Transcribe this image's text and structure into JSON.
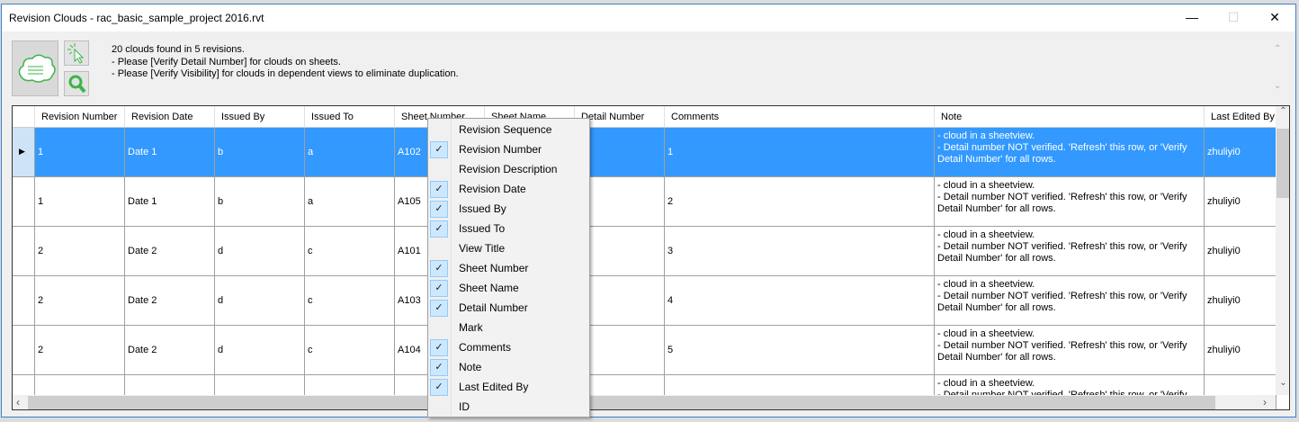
{
  "window": {
    "title": "Revision Clouds - rac_basic_sample_project 2016.rvt",
    "minimize": "—",
    "maximize": "☐",
    "close": "✕"
  },
  "toolbar": {
    "main_icon": "revision-cloud-icon",
    "select_icon": "cursor-select-icon",
    "zoom_icon": "magnifier-icon"
  },
  "message": {
    "line1": "20 clouds found in 5 revisions.",
    "line2": "- Please [Verify Detail Number] for clouds on sheets.",
    "line3": "- Please [Verify Visibility] for clouds in dependent views to eliminate duplication."
  },
  "grid": {
    "columns": [
      "Revision Number",
      "Revision Date",
      "Issued By",
      "Issued To",
      "Sheet Number",
      "Sheet Name",
      "Detail Number",
      "Comments",
      "Note",
      "Last Edited By"
    ],
    "rows": [
      {
        "rev": "1",
        "date": "Date 1",
        "by": "b",
        "to": "a",
        "sheet": "A102",
        "name": "",
        "detail": "",
        "comments": "1",
        "note": "- cloud in a sheetview.\n- Detail number NOT verified. 'Refresh' this row, or 'Verify Detail Number' for all rows.",
        "edited": "zhuliyi0"
      },
      {
        "rev": "1",
        "date": "Date 1",
        "by": "b",
        "to": "a",
        "sheet": "A105",
        "name": "",
        "detail": "",
        "comments": "2",
        "note": "- cloud in a sheetview.\n- Detail number NOT verified. 'Refresh' this row, or 'Verify Detail Number' for all rows.",
        "edited": "zhuliyi0"
      },
      {
        "rev": "2",
        "date": "Date 2",
        "by": "d",
        "to": "c",
        "sheet": "A101",
        "name": "",
        "detail": "",
        "comments": "3",
        "note": "- cloud in a sheetview.\n- Detail number NOT verified. 'Refresh' this row, or 'Verify Detail Number' for all rows.",
        "edited": "zhuliyi0"
      },
      {
        "rev": "2",
        "date": "Date 2",
        "by": "d",
        "to": "c",
        "sheet": "A103",
        "name": "",
        "detail": "",
        "comments": "4",
        "note": "- cloud in a sheetview.\n- Detail number NOT verified. 'Refresh' this row, or 'Verify Detail Number' for all rows.",
        "edited": "zhuliyi0"
      },
      {
        "rev": "2",
        "date": "Date 2",
        "by": "d",
        "to": "c",
        "sheet": "A104",
        "name": "",
        "detail": "",
        "comments": "5",
        "note": "- cloud in a sheetview.\n- Detail number NOT verified. 'Refresh' this row, or 'Verify Detail Number' for all rows.",
        "edited": "zhuliyi0"
      },
      {
        "rev": "",
        "date": "",
        "by": "",
        "to": "",
        "sheet": "",
        "name": "",
        "detail": "",
        "comments": "",
        "note": "- cloud in a sheetview.\n- Detail number NOT verified. 'Refresh' this row, or 'Verify Detail Number' for all rows.",
        "edited": ""
      }
    ],
    "selected_row": 0
  },
  "context_menu": {
    "items": [
      {
        "label": "Revision Sequence",
        "checked": false
      },
      {
        "label": "Revision Number",
        "checked": true
      },
      {
        "label": "Revision Description",
        "checked": false
      },
      {
        "label": "Revision Date",
        "checked": true
      },
      {
        "label": "Issued By",
        "checked": true
      },
      {
        "label": "Issued To",
        "checked": true
      },
      {
        "label": "View Title",
        "checked": false
      },
      {
        "label": "Sheet Number",
        "checked": true
      },
      {
        "label": "Sheet Name",
        "checked": true
      },
      {
        "label": "Detail Number",
        "checked": true
      },
      {
        "label": "Mark",
        "checked": false
      },
      {
        "label": "Comments",
        "checked": true
      },
      {
        "label": "Note",
        "checked": true
      },
      {
        "label": "Last Edited By",
        "checked": true
      },
      {
        "label": "ID",
        "checked": false
      }
    ]
  },
  "colors": {
    "selection": "#3399ff",
    "accent_green": "#3cb44b"
  }
}
